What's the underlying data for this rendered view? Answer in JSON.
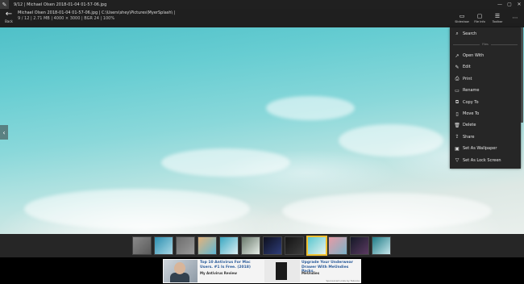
{
  "titlebar": {
    "title": "9/12 | Michael Olsen  2018-01-04 01-57-06.jpg",
    "controls": [
      "—",
      "▢",
      "✕"
    ]
  },
  "header": {
    "back_label": "Back",
    "file_line": "Michael Olsen  2018-01-04 01-57-06.jpg | C:\\Users\\shey\\Pictures\\MyerSplash\\ |",
    "meta_line": "9  /  12  |  2.71 MB  |  4000  ×  3000  |  BGR 24  |  100%",
    "tools": [
      {
        "icon": "slideshow-icon",
        "glyph": "▭",
        "label": "Slideshow"
      },
      {
        "icon": "info-icon",
        "glyph": "▢",
        "label": "File Info"
      },
      {
        "icon": "toolbar-icon",
        "glyph": "☰",
        "label": "Toolbar"
      },
      {
        "icon": "more-icon",
        "glyph": "⋯",
        "label": ""
      }
    ]
  },
  "menu": {
    "search": {
      "glyph": "⌕",
      "label": "Search"
    },
    "divider_label": "Files",
    "items": [
      {
        "name": "open-with",
        "glyph": "↗",
        "label": "Open With"
      },
      {
        "name": "edit",
        "glyph": "✎",
        "label": "Edit"
      },
      {
        "name": "print",
        "glyph": "⎙",
        "label": "Print"
      },
      {
        "name": "rename",
        "glyph": "▭",
        "label": "Rename"
      },
      {
        "name": "copy-to",
        "glyph": "⧉",
        "label": "Copy To"
      },
      {
        "name": "move-to",
        "glyph": "▯",
        "label": "Move To"
      },
      {
        "name": "delete",
        "glyph": "🗑",
        "label": "Delete"
      },
      {
        "name": "share",
        "glyph": "⇪",
        "label": "Share"
      },
      {
        "name": "set-as-wallpaper",
        "glyph": "▣",
        "label": "Set As Wallpaper"
      },
      {
        "name": "set-as-lock-screen",
        "glyph": "▽",
        "label": "Set As Lock Screen"
      }
    ]
  },
  "nav": {
    "prev": "‹",
    "next": "›"
  },
  "thumbnails": [
    {
      "c1": "#8a8a8a",
      "c2": "#5a5a5a"
    },
    {
      "c1": "#2c8fb0",
      "c2": "#a9d8e6"
    },
    {
      "c1": "#6d6d6d",
      "c2": "#9a9a9a"
    },
    {
      "c1": "#e4b27a",
      "c2": "#5fb7d4"
    },
    {
      "c1": "#3aa7c1",
      "c2": "#dbeff3"
    },
    {
      "c1": "#6a7a6c",
      "c2": "#e5ece6"
    },
    {
      "c1": "#0d0f1c",
      "c2": "#2e3d7a"
    },
    {
      "c1": "#141414",
      "c2": "#3c3c3c"
    },
    {
      "c1": "#58c7cf",
      "c2": "#e7f2ef"
    },
    {
      "c1": "#e79aa4",
      "c2": "#7bb3c9"
    },
    {
      "c1": "#141826",
      "c2": "#5c3a62"
    },
    {
      "c1": "#1f7b86",
      "c2": "#c7e7ec"
    }
  ],
  "selected_index": 8,
  "ad": {
    "headline1": "Top 10 Antivirus For Mac Users. #1 Is Free. (2018)",
    "source1": "My Antivirus Review",
    "headline2": "Upgrade Your Underwear Drawer With MeUndies Packs",
    "source2": "MeUndies",
    "footer": "Sponsored Links by Taboola"
  }
}
